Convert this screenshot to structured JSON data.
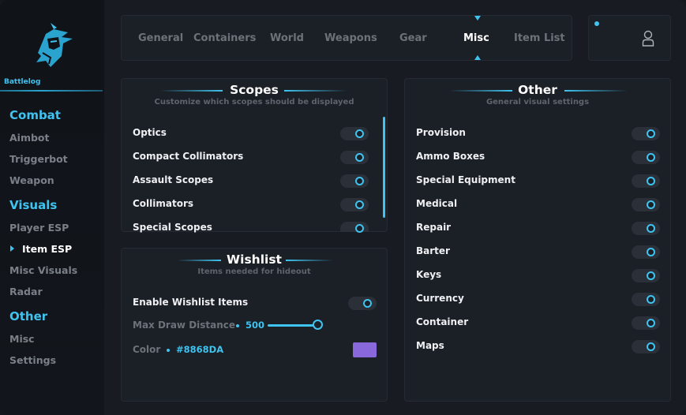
{
  "brand": "Battlelog",
  "sidebar": {
    "sections": [
      {
        "title": "Combat",
        "items": [
          "Aimbot",
          "Triggerbot",
          "Weapon"
        ]
      },
      {
        "title": "Visuals",
        "items": [
          "Player ESP",
          "Item ESP",
          "Misc Visuals",
          "Radar"
        ]
      },
      {
        "title": "Other",
        "items": [
          "Misc",
          "Settings"
        ]
      }
    ],
    "active_item": "Item ESP"
  },
  "tabs": [
    "General",
    "Containers",
    "World",
    "Weapons",
    "Gear",
    "Misc",
    "Item List"
  ],
  "active_tab": "Misc",
  "icons": {
    "logo": "knight-helmet-logo",
    "user": "user-icon"
  },
  "colors": {
    "accent": "#3fc3f0",
    "background": "#181b21",
    "panel": "#1b1f26",
    "wishlist_color": "#8868DA"
  },
  "scopes": {
    "title": "Scopes",
    "subtitle": "Customize which scopes should be displayed",
    "items": [
      {
        "label": "Optics",
        "enabled": true
      },
      {
        "label": "Compact Collimators",
        "enabled": true
      },
      {
        "label": "Assault Scopes",
        "enabled": true
      },
      {
        "label": "Collimators",
        "enabled": true
      },
      {
        "label": "Special Scopes",
        "enabled": true
      }
    ]
  },
  "wishlist": {
    "title": "Wishlist",
    "subtitle": "Items needed for hideout",
    "enable_label": "Enable Wishlist Items",
    "enabled": true,
    "max_draw_label": "Max Draw Distance",
    "max_draw_value": "500",
    "color_label": "Color",
    "color_value": "#8868DA"
  },
  "other": {
    "title": "Other",
    "subtitle": "General visual settings",
    "items": [
      {
        "label": "Provision",
        "enabled": true
      },
      {
        "label": "Ammo Boxes",
        "enabled": true
      },
      {
        "label": "Special Equipment",
        "enabled": true
      },
      {
        "label": "Medical",
        "enabled": true
      },
      {
        "label": "Repair",
        "enabled": true
      },
      {
        "label": "Barter",
        "enabled": true
      },
      {
        "label": "Keys",
        "enabled": true
      },
      {
        "label": "Currency",
        "enabled": true
      },
      {
        "label": "Container",
        "enabled": true
      },
      {
        "label": "Maps",
        "enabled": true
      }
    ]
  }
}
